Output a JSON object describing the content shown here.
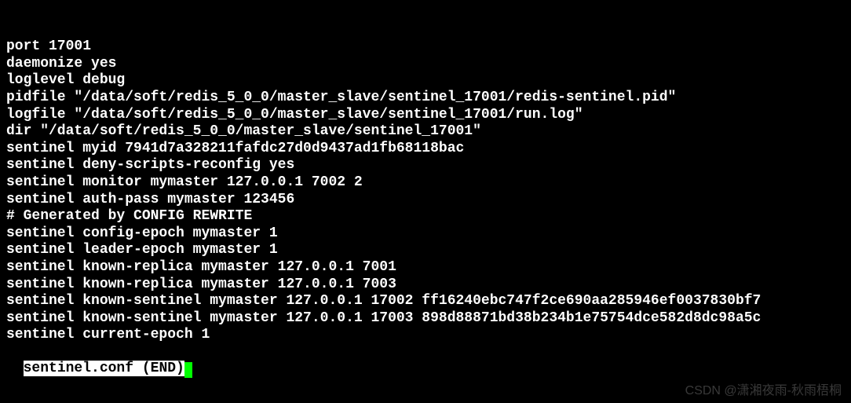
{
  "lines": [
    "port 17001",
    "daemonize yes",
    "loglevel debug",
    "pidfile \"/data/soft/redis_5_0_0/master_slave/sentinel_17001/redis-sentinel.pid\"",
    "logfile \"/data/soft/redis_5_0_0/master_slave/sentinel_17001/run.log\"",
    "dir \"/data/soft/redis_5_0_0/master_slave/sentinel_17001\"",
    "sentinel myid 7941d7a328211fafdc27d0d9437ad1fb68118bac",
    "sentinel deny-scripts-reconfig yes",
    "sentinel monitor mymaster 127.0.0.1 7002 2",
    "sentinel auth-pass mymaster 123456",
    "# Generated by CONFIG REWRITE",
    "sentinel config-epoch mymaster 1",
    "sentinel leader-epoch mymaster 1",
    "sentinel known-replica mymaster 127.0.0.1 7001",
    "sentinel known-replica mymaster 127.0.0.1 7003",
    "sentinel known-sentinel mymaster 127.0.0.1 17002 ff16240ebc747f2ce690aa285946ef0037830bf7",
    "sentinel known-sentinel mymaster 127.0.0.1 17003 898d88871bd38b234b1e75754dce582d8dc98a5c",
    "sentinel current-epoch 1"
  ],
  "end_marker": "sentinel.conf (END)",
  "watermark": "CSDN @潇湘夜雨-秋雨梧桐"
}
